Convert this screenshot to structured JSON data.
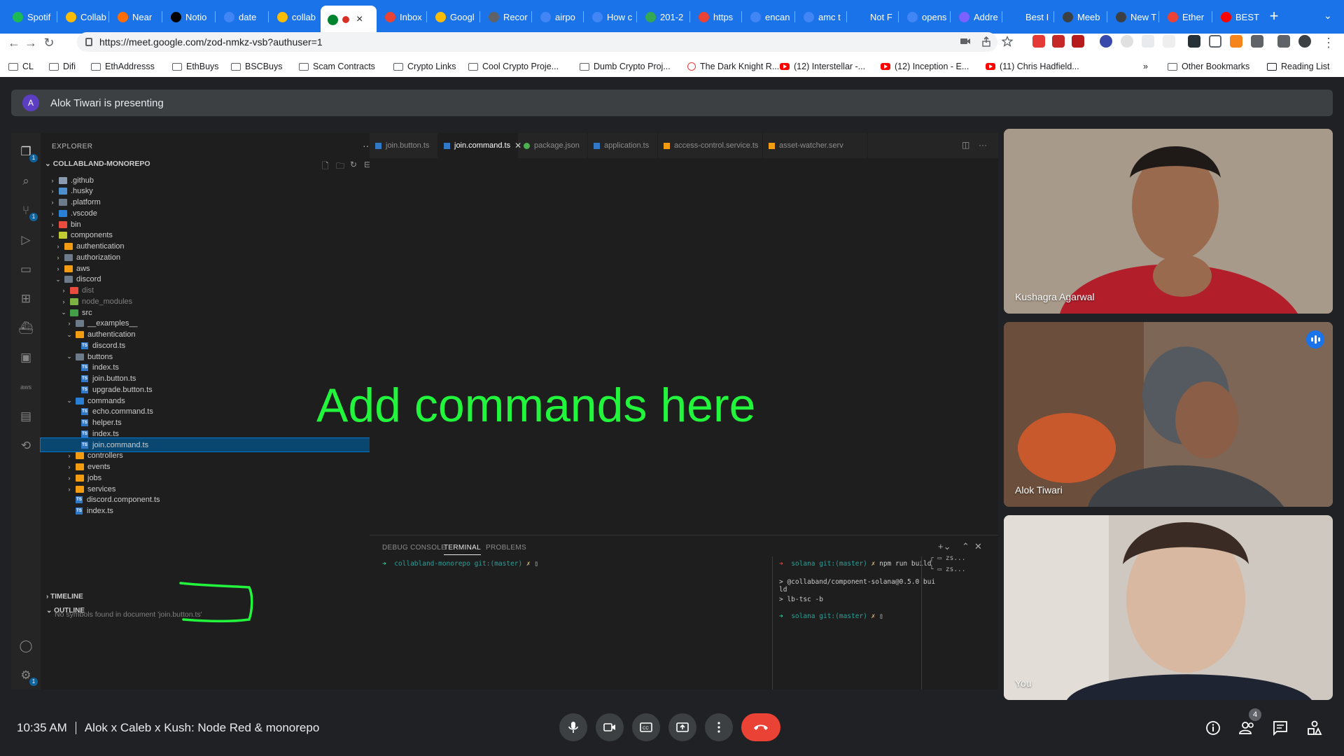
{
  "browser": {
    "tabs": [
      {
        "label": "Spotif",
        "icon": "spotify-icon",
        "color": "#1db954"
      },
      {
        "label": "Collab",
        "icon": "drive-icon",
        "color": "#fbbc04"
      },
      {
        "label": "Near",
        "icon": "near-icon",
        "color": "#ff6d00"
      },
      {
        "label": "Notio",
        "icon": "notion-icon",
        "color": "#000000"
      },
      {
        "label": "date",
        "icon": "google-icon",
        "color": "#4285f4"
      },
      {
        "label": "collab",
        "icon": "docs-icon",
        "color": "#fbbc04"
      },
      {
        "label": "",
        "icon": "meet-icon",
        "color": "#00832d",
        "active": true
      },
      {
        "label": "Inbox",
        "icon": "gmail-icon",
        "color": "#ea4335"
      },
      {
        "label": "Googl",
        "icon": "sheets-icon",
        "color": "#fbbc04"
      },
      {
        "label": "Recor",
        "icon": "record-icon",
        "color": "#5f6368"
      },
      {
        "label": "airpo",
        "icon": "google-icon",
        "color": "#4285f4"
      },
      {
        "label": "How c",
        "icon": "google-icon",
        "color": "#4285f4"
      },
      {
        "label": "201-2",
        "icon": "drive-icon",
        "color": "#34a853"
      },
      {
        "label": "https",
        "icon": "gmail-icon",
        "color": "#ea4335"
      },
      {
        "label": "encan",
        "icon": "google-icon",
        "color": "#4285f4"
      },
      {
        "label": "amc t",
        "icon": "google-icon",
        "color": "#4285f4"
      },
      {
        "label": "Not F",
        "icon": "site-icon",
        "color": "#1a73e8"
      },
      {
        "label": "opens",
        "icon": "google-icon",
        "color": "#4285f4"
      },
      {
        "label": "Addre",
        "icon": "site-icon",
        "color": "#7b61ff"
      },
      {
        "label": "Best I",
        "icon": "site-icon",
        "color": "#1a73e8"
      },
      {
        "label": "Meeb",
        "icon": "site-icon",
        "color": "#3c4043"
      },
      {
        "label": "New T",
        "icon": "site-icon",
        "color": "#3c4043"
      },
      {
        "label": "Ether",
        "icon": "site-icon",
        "color": "#ea4335"
      },
      {
        "label": "BEST",
        "icon": "youtube-icon",
        "color": "#ff0000"
      }
    ],
    "new_tab": "+",
    "url": "https://meet.google.com/zod-nmkz-vsb?authuser=1",
    "bookmarks": [
      {
        "label": "CL",
        "type": "folder"
      },
      {
        "label": "Difi",
        "type": "folder"
      },
      {
        "label": "EthAddresss",
        "type": "folder"
      },
      {
        "label": "EthBuys",
        "type": "folder"
      },
      {
        "label": "BSCBuys",
        "type": "folder"
      },
      {
        "label": "Scam Contracts",
        "type": "folder"
      },
      {
        "label": "Crypto Links",
        "type": "folder"
      },
      {
        "label": "Cool Crypto Proje...",
        "type": "folder"
      },
      {
        "label": "Dumb Crypto Proj...",
        "type": "folder"
      },
      {
        "label": "The Dark Knight R...",
        "type": "site"
      },
      {
        "label": "(12) Interstellar -...",
        "type": "youtube"
      },
      {
        "label": "(12) Inception - E...",
        "type": "youtube"
      },
      {
        "label": "(11) Chris Hadfield...",
        "type": "youtube"
      },
      {
        "label": "»",
        "type": "more"
      },
      {
        "label": "Other Bookmarks",
        "type": "folder"
      },
      {
        "label": "Reading List",
        "type": "reading"
      }
    ]
  },
  "meet": {
    "presenting_avatar": "A",
    "presenting_text": "Alok Tiwari is presenting",
    "time": "10:35 AM",
    "meeting_title": "Alok x Caleb x Kush: Node Red & monorepo",
    "participants_count": "4",
    "participants": [
      {
        "name": "Kushagra Agarwal",
        "speaking": false
      },
      {
        "name": "Alok Tiwari",
        "speaking": true
      },
      {
        "name": "You",
        "speaking": false
      }
    ]
  },
  "shared_screen": {
    "annotation": "Add commands here",
    "explorer": {
      "header": "EXPLORER",
      "more": "···",
      "repo": "COLLABLAND-MONOREPO",
      "tree": [
        {
          "label": ".github",
          "depth": 1,
          "open": false,
          "kind": "folder",
          "color": "#8a9bb0"
        },
        {
          "label": ".husky",
          "depth": 1,
          "open": false,
          "kind": "folder",
          "color": "#4d8fcc"
        },
        {
          "label": ".platform",
          "depth": 1,
          "open": false,
          "kind": "folder",
          "color": "#6c7a89"
        },
        {
          "label": ".vscode",
          "depth": 1,
          "open": false,
          "kind": "folder",
          "color": "#2a80d6"
        },
        {
          "label": "bin",
          "depth": 1,
          "open": false,
          "kind": "folder",
          "color": "#e74c3c"
        },
        {
          "label": "components",
          "depth": 1,
          "open": true,
          "kind": "folder",
          "color": "#c0ca33"
        },
        {
          "label": "authentication",
          "depth": 2,
          "open": false,
          "kind": "folder",
          "color": "#f39c12"
        },
        {
          "label": "authorization",
          "depth": 2,
          "open": false,
          "kind": "folder",
          "color": "#6c7a89"
        },
        {
          "label": "aws",
          "depth": 2,
          "open": false,
          "kind": "folder",
          "color": "#f39c12"
        },
        {
          "label": "discord",
          "depth": 2,
          "open": true,
          "kind": "folder",
          "color": "#6c7a89"
        },
        {
          "label": "dist",
          "depth": 3,
          "open": false,
          "kind": "folder",
          "color": "#e74c3c",
          "dim": true
        },
        {
          "label": "node_modules",
          "depth": 3,
          "open": false,
          "kind": "folder",
          "color": "#7cb342",
          "dim": true
        },
        {
          "label": "src",
          "depth": 3,
          "open": true,
          "kind": "folder",
          "color": "#43a047"
        },
        {
          "label": "__examples__",
          "depth": 4,
          "open": false,
          "kind": "folder",
          "color": "#6c7a89"
        },
        {
          "label": "authentication",
          "depth": 4,
          "open": true,
          "kind": "folder",
          "color": "#f39c12"
        },
        {
          "label": "discord.ts",
          "depth": 5,
          "kind": "ts"
        },
        {
          "label": "buttons",
          "depth": 4,
          "open": true,
          "kind": "folder",
          "color": "#6c7a89"
        },
        {
          "label": "index.ts",
          "depth": 5,
          "kind": "ts"
        },
        {
          "label": "join.button.ts",
          "depth": 5,
          "kind": "ts"
        },
        {
          "label": "upgrade.button.ts",
          "depth": 5,
          "kind": "ts"
        },
        {
          "label": "commands",
          "depth": 4,
          "open": true,
          "kind": "folder",
          "color": "#2a80d6"
        },
        {
          "label": "echo.command.ts",
          "depth": 5,
          "kind": "ts"
        },
        {
          "label": "helper.ts",
          "depth": 5,
          "kind": "ts"
        },
        {
          "label": "index.ts",
          "depth": 5,
          "kind": "ts"
        },
        {
          "label": "join.command.ts",
          "depth": 5,
          "kind": "ts",
          "selected": true
        },
        {
          "label": "controllers",
          "depth": 4,
          "open": false,
          "kind": "folder",
          "color": "#f39c12"
        },
        {
          "label": "events",
          "depth": 4,
          "open": false,
          "kind": "folder",
          "color": "#f39c12"
        },
        {
          "label": "jobs",
          "depth": 4,
          "open": false,
          "kind": "folder",
          "color": "#f39c12"
        },
        {
          "label": "services",
          "depth": 4,
          "open": false,
          "kind": "folder",
          "color": "#f39c12"
        },
        {
          "label": "discord.component.ts",
          "depth": 4,
          "kind": "ts"
        },
        {
          "label": "index.ts",
          "depth": 4,
          "kind": "ts"
        }
      ],
      "timeline": "TIMELINE",
      "outline": "OUTLINE",
      "outline_message": "No symbols found in document 'join.button.ts'"
    },
    "editor_tabs": [
      {
        "label": "join.button.ts",
        "modified": true,
        "kind": "ts"
      },
      {
        "label": "join.command.ts",
        "active": true,
        "kind": "ts"
      },
      {
        "label": "package.json",
        "kind": "json"
      },
      {
        "label": "application.ts",
        "kind": "ts"
      },
      {
        "label": "access-control.service.ts",
        "kind": "svc"
      },
      {
        "label": "asset-watcher.serv",
        "kind": "svc"
      }
    ],
    "panel": {
      "tabs": [
        "DEBUG CONSOLE",
        "TERMINAL",
        "PROBLEMS"
      ],
      "active_tab": "TERMINAL",
      "term_left": {
        "dir": "collabland-monorepo",
        "git": "git:(master)",
        "x": "✗"
      },
      "term_right": {
        "dir": "solana",
        "git": "git:(master)",
        "x": "✗",
        "cmd": "npm run build",
        "out1": "> @collaband/component-solana@0.5.0 bui",
        "out2": "ld",
        "out3": "> lb-tsc -b"
      },
      "shells": [
        "zs...",
        "zs..."
      ]
    }
  }
}
